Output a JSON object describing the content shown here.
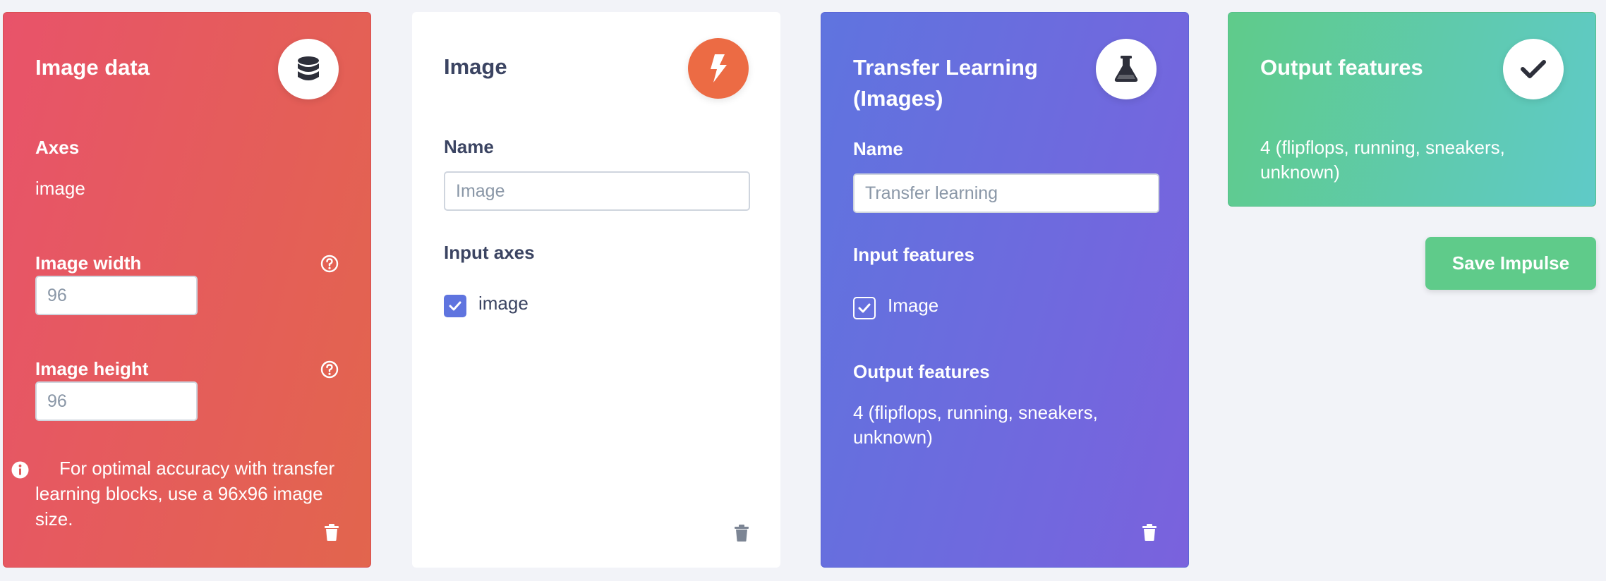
{
  "image_data_card": {
    "title": "Image data",
    "icon": "database-icon",
    "axes_label": "Axes",
    "axes_value": "image",
    "width_label": "Image width",
    "width_value": "96",
    "height_label": "Image height",
    "height_value": "96",
    "info_text": "For optimal accuracy with transfer learning blocks, use a 96x96 image size."
  },
  "image_block_card": {
    "title": "Image",
    "icon": "bolt-icon",
    "name_label": "Name",
    "name_placeholder": "Image",
    "input_axes_label": "Input axes",
    "axis_checkbox_label": "image"
  },
  "transfer_learning_card": {
    "title_line1": "Transfer Learning",
    "title_line2": "(Images)",
    "icon": "flask-icon",
    "name_label": "Name",
    "name_placeholder": "Transfer learning",
    "input_features_label": "Input features",
    "input_feature_checkbox_label": "Image",
    "output_features_label": "Output features",
    "output_features_line1": "4 (flipflops, running, sneakers,",
    "output_features_line2": "unknown)"
  },
  "output_features_card": {
    "title": "Output features",
    "icon": "check-icon",
    "value_line1": "4 (flipflops, running, sneakers,",
    "value_line2": "unknown)"
  },
  "save_button_label": "Save Impulse",
  "colors": {
    "input_block_gradient": [
      "#e8536a",
      "#e2654d"
    ],
    "processing_accent": "#ec6b44",
    "learning_gradient": [
      "#5f74df",
      "#7a62dd"
    ],
    "output_gradient": [
      "#5fcb8a",
      "#5fcac8"
    ],
    "checkbox_blue": "#5f74df"
  }
}
